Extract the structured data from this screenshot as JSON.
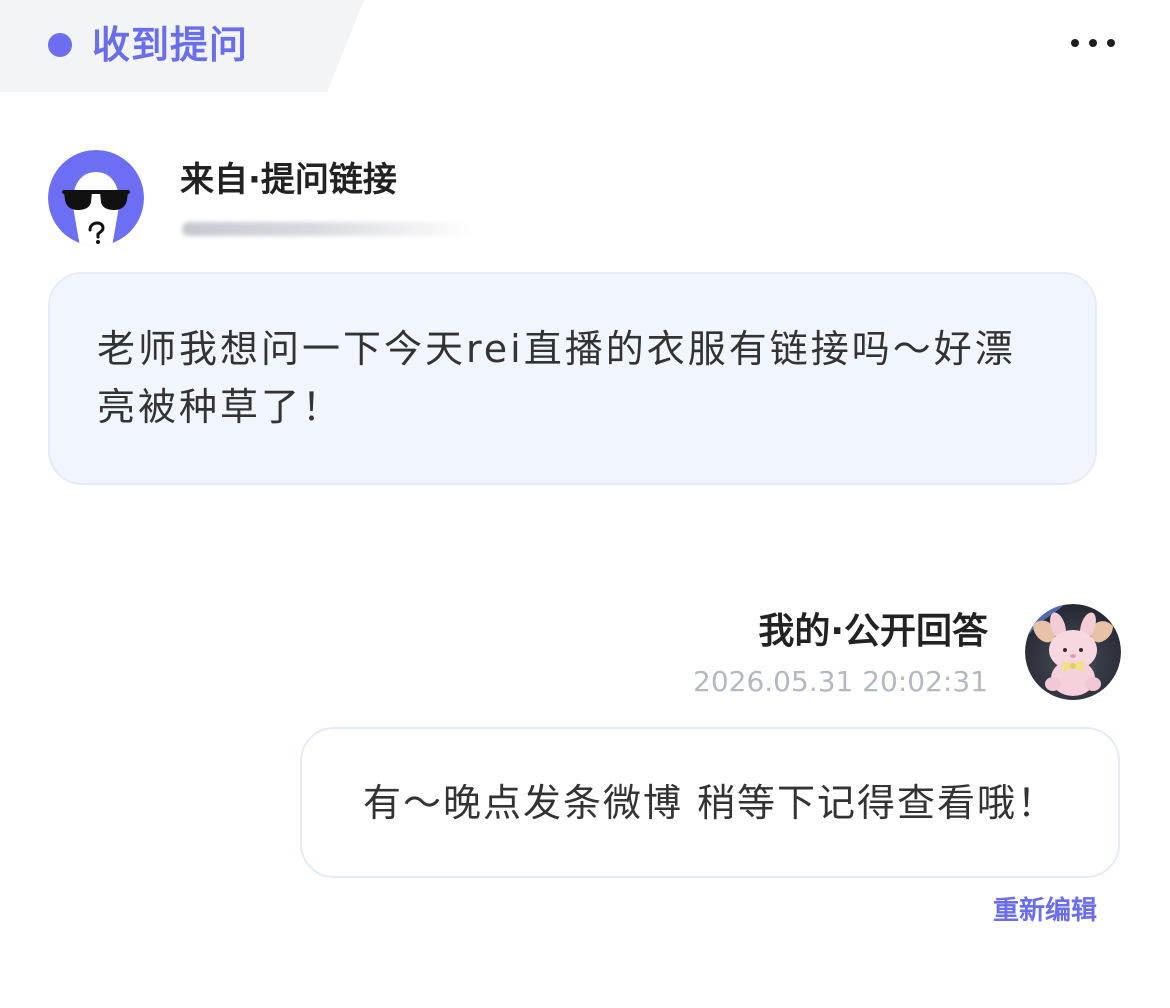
{
  "header": {
    "title": "收到提问",
    "status_dot_icon": "dot-icon",
    "more_icon": "more-horizontal-icon"
  },
  "question": {
    "avatar_icon": "anonymous-sunglasses-avatar",
    "sender_label": "来自·提问链接",
    "text": "老师我想问一下今天rei直播的衣服有链接吗～好漂亮被种草了！"
  },
  "answer": {
    "label": "我的·公开回答",
    "timestamp": "2026.05.31 20:02:31",
    "avatar_icon": "plush-bunny-photo-avatar",
    "text": "有～晚点发条微博 稍等下记得查看哦！",
    "edit_label": "重新编辑"
  },
  "colors": {
    "accent": "#6B6EEA",
    "header_tab_bg": "#F3F4F6",
    "question_bubble_bg": "#F1F5FE",
    "answer_bubble_bg": "#FFFFFF",
    "timestamp": "#B4B8C2"
  }
}
